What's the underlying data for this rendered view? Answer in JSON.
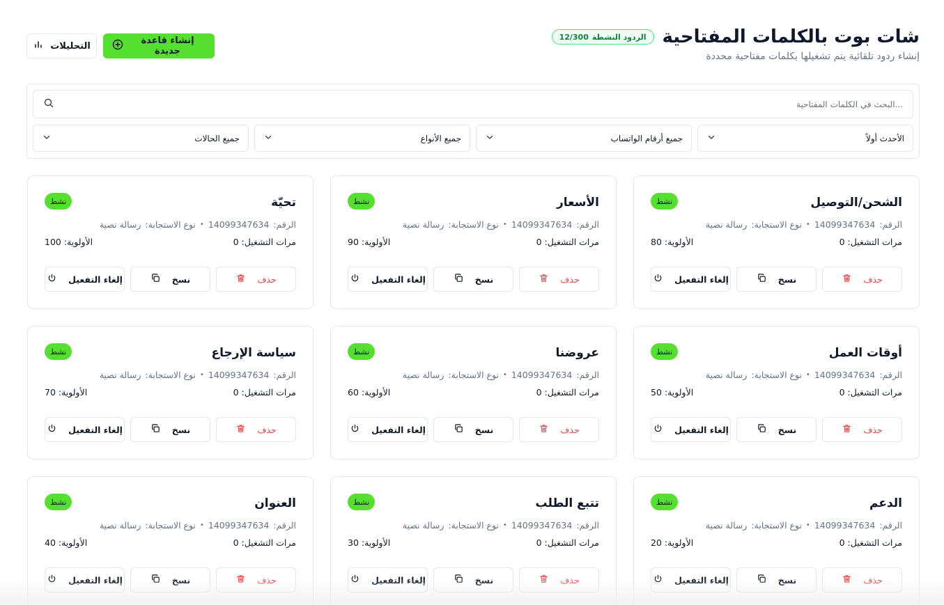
{
  "header": {
    "title": "شات بوت بالكلمات المفتاحية",
    "quota_label": "الردود النشطة",
    "quota_value": "12/300",
    "subtitle": "إنشاء ردود تلقائية يتم تشغيلها بكلمات مفتاحية محددة",
    "create_button": "إنشاء قاعدة جديدة",
    "analytics_button": "التحليلات"
  },
  "filters": {
    "search_placeholder": "...البحث في الكلمات المفتاحية",
    "sort": "الأحدث أولاً",
    "numbers": "جميع أرقام الواتساب",
    "types": "جميع الأنواع",
    "statuses": "جميع الحالات"
  },
  "card_labels": {
    "number_prefix": "الرقم:",
    "type_prefix": "نوع الاستجابة:",
    "runs_prefix": "مرات التشغيل:",
    "priority_prefix": "الأولوية:",
    "delete": "حذف",
    "copy": "نسخ",
    "deactivate": "إلغاء التفعيل"
  },
  "rules": [
    {
      "title": "الشحن/التوصيل",
      "status": "نشط",
      "number": "14099347634",
      "type": "رسالة نصية",
      "runs": "0",
      "priority": "80"
    },
    {
      "title": "الأسعار",
      "status": "نشط",
      "number": "14099347634",
      "type": "رسالة نصية",
      "runs": "0",
      "priority": "90"
    },
    {
      "title": "تحيّة",
      "status": "نشط",
      "number": "14099347634",
      "type": "رسالة نصية",
      "runs": "0",
      "priority": "100"
    },
    {
      "title": "أوقات العمل",
      "status": "نشط",
      "number": "14099347634",
      "type": "رسالة نصية",
      "runs": "0",
      "priority": "50"
    },
    {
      "title": "عروضنا",
      "status": "نشط",
      "number": "14099347634",
      "type": "رسالة نصية",
      "runs": "0",
      "priority": "60"
    },
    {
      "title": "سياسة الإرجاع",
      "status": "نشط",
      "number": "14099347634",
      "type": "رسالة نصية",
      "runs": "0",
      "priority": "70"
    },
    {
      "title": "الدعم",
      "status": "نشط",
      "number": "14099347634",
      "type": "رسالة نصية",
      "runs": "0",
      "priority": "20"
    },
    {
      "title": "تتبع الطلب",
      "status": "نشط",
      "number": "14099347634",
      "type": "رسالة نصية",
      "runs": "0",
      "priority": "30"
    },
    {
      "title": "العنوان",
      "status": "نشط",
      "number": "14099347634",
      "type": "رسالة نصية",
      "runs": "0",
      "priority": "40"
    }
  ]
}
